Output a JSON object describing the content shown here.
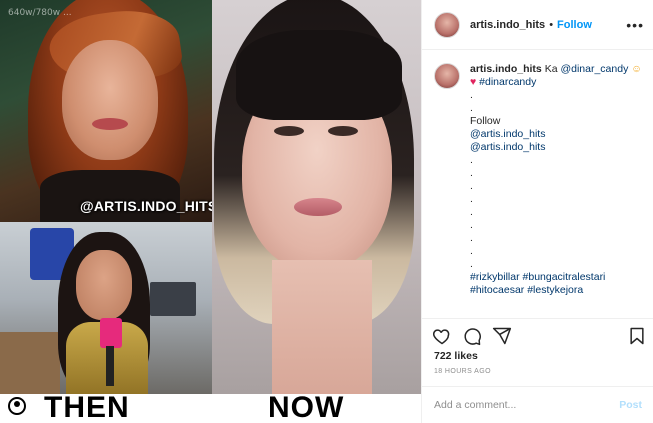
{
  "media": {
    "watermark_size": "640w/780w ...",
    "handle_overlay": "@ARTIS.INDO_HITS",
    "label_then": "THEN",
    "label_now": "NOW",
    "mic_caption": "..."
  },
  "post": {
    "username": "artis.indo_hits",
    "follow_label": "Follow",
    "more_label": "•••",
    "caption": {
      "username": "artis.indo_hits",
      "text_before_mention": "Ka",
      "mention": "@dinar_candy",
      "face_emoji": "☺",
      "heart_emoji": "♥",
      "hashtag_line1": "#dinarcandy",
      "dot": ".",
      "follow_text": "Follow",
      "handle_1": "@artis.indo_hits",
      "handle_2": "@artis.indo_hits",
      "hashtags": "#rizkybillar #bungacitralestari",
      "hashtags_2": "#hitocaesar #lestykejora"
    },
    "likes": "722 likes",
    "timestamp": "18 HOURS AGO",
    "comment_placeholder": "Add a comment...",
    "post_button": "Post"
  },
  "colors": {
    "accent_link": "#00376b",
    "follow_blue": "#0095f6",
    "post_disabled": "#b2dffc"
  },
  "icons": [
    "heart-icon",
    "comment-icon",
    "share-icon",
    "bookmark-icon",
    "more-icon"
  ]
}
